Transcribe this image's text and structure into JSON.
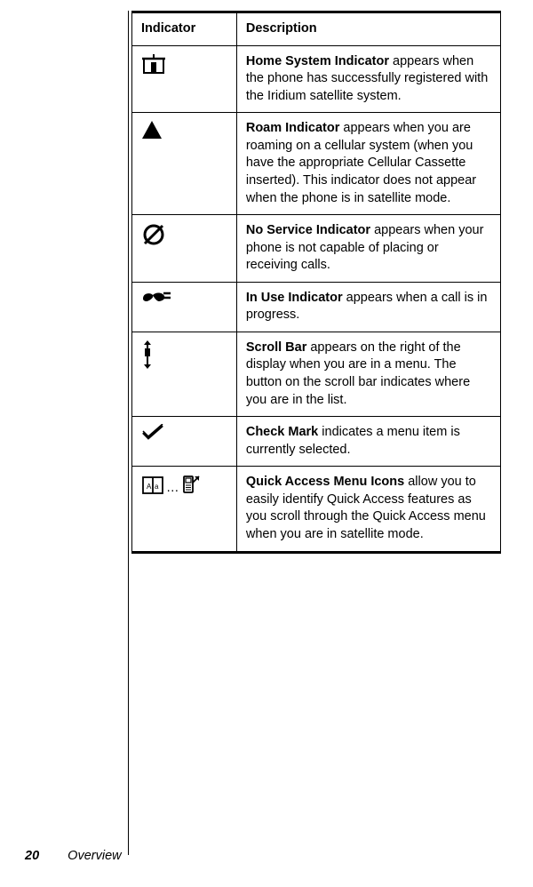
{
  "table": {
    "headers": {
      "indicator": "Indicator",
      "description": "Description"
    },
    "rows": [
      {
        "icon": "home-system-icon",
        "bold": "Home System Indicator",
        "rest": " appears when the phone has successfully registered with the Iridium satellite system."
      },
      {
        "icon": "roam-icon",
        "bold": "Roam Indicator",
        "rest": " appears when you are roaming on a cellular system (when you have the appropriate Cellular Cassette inserted). This indicator does not appear when the phone is in satellite mode."
      },
      {
        "icon": "no-service-icon",
        "bold": "No Service Indicator",
        "rest": " appears when your phone is not capable of placing or receiving calls."
      },
      {
        "icon": "in-use-icon",
        "bold": "In Use Indicator",
        "rest": " appears when a call is in progress."
      },
      {
        "icon": "scroll-bar-icon",
        "bold": "Scroll Bar",
        "rest": " appears on the right of the display when you are in a menu. The button on the scroll bar indicates where you are in the list."
      },
      {
        "icon": "check-mark-icon",
        "bold": "Check Mark",
        "rest": " indicates a menu item is currently selected."
      },
      {
        "icon": "quick-access-icons",
        "bold": "Quick Access Menu Icons",
        "rest": " allow you to easily identify Quick Access features as you scroll through the Quick Access menu when you are in satellite mode."
      }
    ]
  },
  "footer": {
    "page_number": "20",
    "section": "Overview"
  },
  "quick_access_separator": "…"
}
